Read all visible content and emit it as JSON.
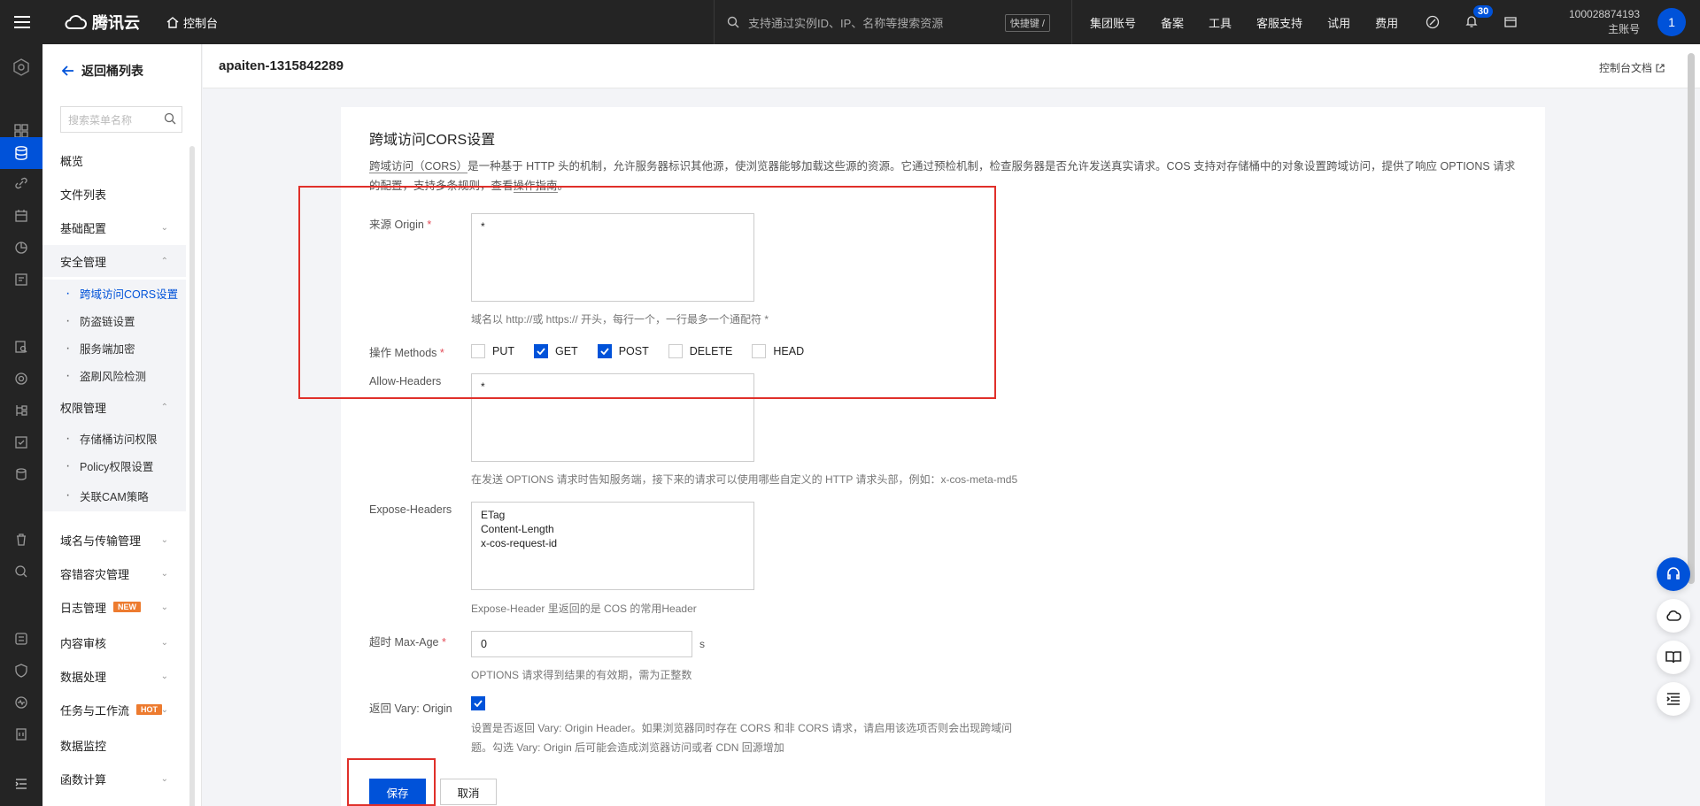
{
  "topbar": {
    "brand": "腾讯云",
    "console": "控制台",
    "search_placeholder": "支持通过实例ID、IP、名称等搜索资源",
    "shortcut": "快捷键 /",
    "nav": [
      "集团账号",
      "备案",
      "工具",
      "客服支持",
      "试用",
      "费用"
    ],
    "notification_count": "30",
    "account_id": "100028874193",
    "account_role": "主账号",
    "avatar_letter": "1"
  },
  "sidebar": {
    "back_label": "返回桶列表",
    "search_placeholder": "搜索菜单名称",
    "items": {
      "overview": "概览",
      "file_list": "文件列表",
      "basic_config": "基础配置",
      "security": "安全管理",
      "cors": "跨域访问CORS设置",
      "hotlink": "防盗链设置",
      "encryption": "服务端加密",
      "risk_detect": "盗刷风险检测",
      "permission": "权限管理",
      "bucket_access": "存储桶访问权限",
      "policy": "Policy权限设置",
      "cam_policy": "关联CAM策略",
      "domain": "域名与传输管理",
      "disaster": "容错容灾管理",
      "logs": "日志管理",
      "logs_tag": "NEW",
      "content_audit": "内容审核",
      "data_process": "数据处理",
      "tasks": "任务与工作流",
      "tasks_tag": "HOT",
      "data_monitor": "数据监控",
      "functions": "函数计算"
    }
  },
  "header": {
    "bucket_name": "apaiten-1315842289",
    "doc_link": "控制台文档"
  },
  "form": {
    "title": "跨域访问CORS设置",
    "desc_link": "跨域访问（CORS）",
    "desc_body": "是一种基于 HTTP 头的机制，允许服务器标识其他源，使浏览器能够加载这些源的资源。它通过预检机制，检查服务器是否允许发送真实请求。COS 支持对存储桶中的对象设置跨域访问，提供了响应 OPTIONS 请求的配置，支持多条规则，查看",
    "desc_guide": "操作指南",
    "desc_end": "。",
    "origin_label": "来源 Origin",
    "origin_value": "*",
    "origin_hint": "域名以 http://或 https:// 开头，每行一个，一行最多一个通配符 *",
    "methods_label": "操作 Methods",
    "methods": [
      {
        "name": "PUT",
        "checked": false
      },
      {
        "name": "GET",
        "checked": true
      },
      {
        "name": "POST",
        "checked": true
      },
      {
        "name": "DELETE",
        "checked": false
      },
      {
        "name": "HEAD",
        "checked": false
      }
    ],
    "allow_headers_label": "Allow-Headers",
    "allow_headers_value": "*",
    "allow_headers_hint": "在发送 OPTIONS 请求时告知服务端，接下来的请求可以使用哪些自定义的 HTTP 请求头部，例如：x-cos-meta-md5",
    "expose_headers_label": "Expose-Headers",
    "expose_headers_value": "ETag\nContent-Length\nx-cos-request-id",
    "expose_headers_hint": "Expose-Header 里返回的是 COS 的常用Header",
    "max_age_label": "超时 Max-Age",
    "max_age_value": "0",
    "max_age_unit": "s",
    "max_age_hint": "OPTIONS 请求得到结果的有效期，需为正整数",
    "vary_label": "返回 Vary: Origin",
    "vary_checked": true,
    "vary_hint_1": "设置是否返回 Vary: Origin Header。如果浏览器同时存在 CORS 和非 CORS 请求，请启用该选项否则会出现跨域问",
    "vary_hint_2": "题。勾选 Vary: Origin 后可能会造成浏览器访问或者 CDN 回源增加",
    "save": "保存",
    "cancel": "取消"
  },
  "colors": {
    "brand_blue": "#0052d9",
    "topbar": "#242424",
    "annotation_red": "#e0302a"
  }
}
